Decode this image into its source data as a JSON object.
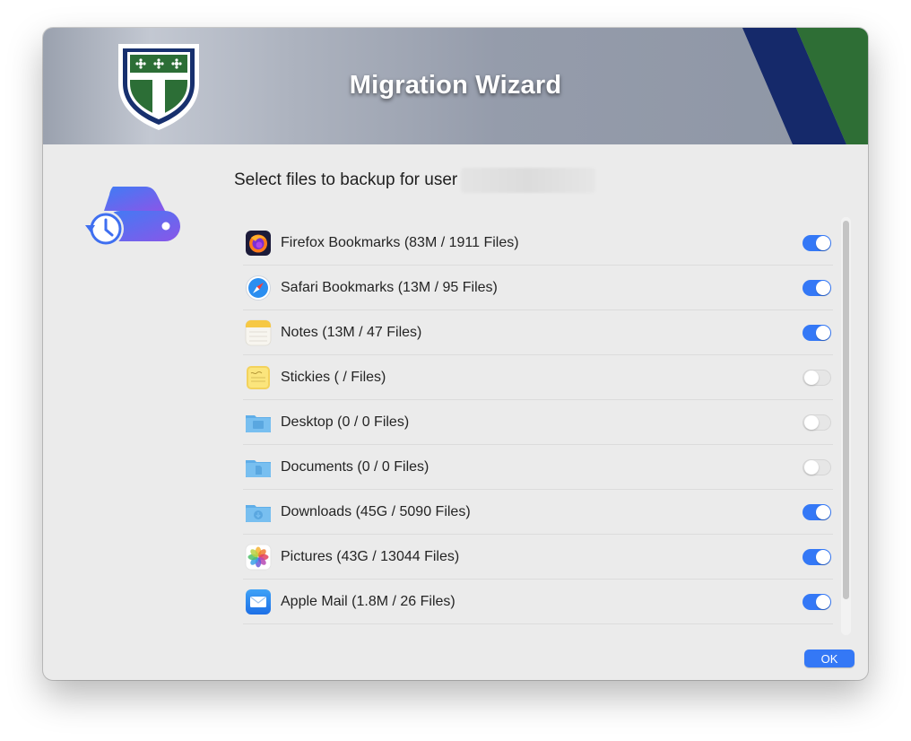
{
  "header": {
    "title": "Migration Wizard",
    "colors": {
      "stripe_blue": "#15296a",
      "stripe_green": "#2e6e35",
      "shield_green": "#2c6e36"
    }
  },
  "main": {
    "prompt": "Select files to backup for user"
  },
  "items": [
    {
      "label": "Firefox Bookmarks (83M / 1911 Files)",
      "icon": "firefox-icon",
      "enabled": true
    },
    {
      "label": "Safari Bookmarks (13M / 95 Files)",
      "icon": "safari-icon",
      "enabled": true
    },
    {
      "label": "Notes (13M / 47 Files)",
      "icon": "notes-icon",
      "enabled": true
    },
    {
      "label": "Stickies ( /  Files)",
      "icon": "stickies-icon",
      "enabled": false
    },
    {
      "label": "Desktop (0 / 0 Files)",
      "icon": "desktop-folder-icon",
      "enabled": false
    },
    {
      "label": "Documents (0 / 0 Files)",
      "icon": "documents-folder-icon",
      "enabled": false
    },
    {
      "label": "Downloads (45G / 5090 Files)",
      "icon": "downloads-folder-icon",
      "enabled": true
    },
    {
      "label": "Pictures (43G / 13044 Files)",
      "icon": "photos-icon",
      "enabled": true
    },
    {
      "label": "Apple Mail (1.8M / 26 Files)",
      "icon": "mail-icon",
      "enabled": true
    }
  ],
  "footer": {
    "ok_label": "OK"
  },
  "accent": "#3478f6"
}
